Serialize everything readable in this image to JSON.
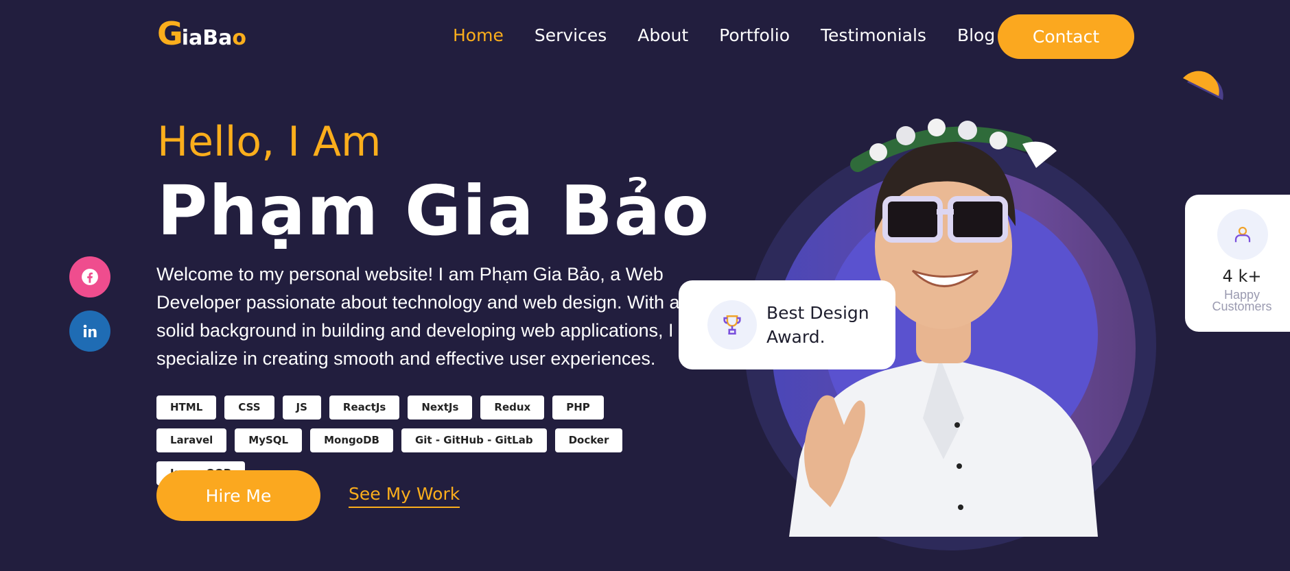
{
  "logo": {
    "big_letter": "G",
    "rest_a": "ia",
    "rest_b": "Ba",
    "rest_c": "o"
  },
  "nav": {
    "items": [
      {
        "label": "Home"
      },
      {
        "label": "Services"
      },
      {
        "label": "About"
      },
      {
        "label": "Portfolio"
      },
      {
        "label": "Testimonials"
      },
      {
        "label": "Blog"
      }
    ],
    "active": "Home",
    "contact_label": "Contact"
  },
  "hero": {
    "greeting": "Hello, I Am",
    "name": "Phạm Gia Bảo",
    "intro": "Welcome to my personal website! I am Phạm Gia Bảo, a Web Developer passionate about technology and web design. With a solid background in building and developing web applications, I specialize in creating smooth and effective user experiences.",
    "skills": [
      "HTML",
      "CSS",
      "JS",
      "ReactJs",
      "NextJs",
      "Redux",
      "PHP",
      "Laravel",
      "MySQL",
      "MongoDB",
      "Git - GitHub - GitLab",
      "Docker",
      "Java - OOP"
    ],
    "hire_label": "Hire Me",
    "work_label": "See My Work"
  },
  "social": {
    "facebook_icon": "facebook-icon",
    "linkedin_icon": "linkedin-icon"
  },
  "award": {
    "line1": "Best Design",
    "line2": "Award.",
    "icon": "trophy-icon"
  },
  "stats": {
    "value": "4 k+",
    "label_line1": "Happy",
    "label_line2": "Customers",
    "icon": "user-icon"
  },
  "colors": {
    "background": "#221e3e",
    "accent": "#fba81f",
    "facebook": "#ef4d8e",
    "linkedin": "#1f6cb4",
    "ring": "#5a52cf"
  }
}
